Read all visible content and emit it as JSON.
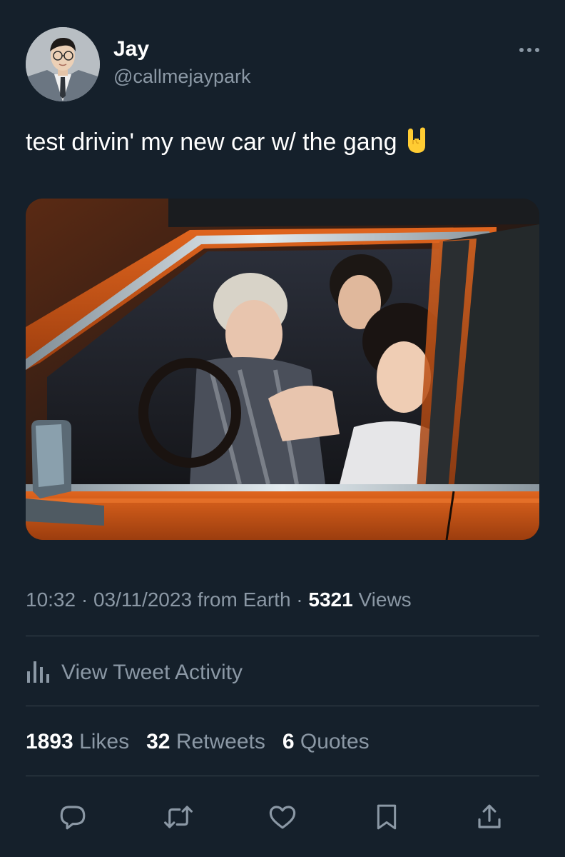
{
  "author": {
    "display_name": "Jay",
    "handle": "@callmejaypark"
  },
  "tweet": {
    "text": "test drivin' my new car w/ the gang",
    "emoji": "sign-of-the-horns"
  },
  "meta": {
    "time": "10:32",
    "separator": " · ",
    "date": "03/11/2023",
    "source": " from Earth",
    "views_count": "5321",
    "views_label": " Views"
  },
  "activity": {
    "label": "View Tweet Activity",
    "icon": "analytics-icon"
  },
  "stats": {
    "likes_count": "1893",
    "likes_label": " Likes",
    "retweets_count": "32",
    "retweets_label": " Retweets",
    "quotes_count": "6",
    "quotes_label": " Quotes"
  },
  "actions": [
    "reply-icon",
    "retweet-icon",
    "like-icon",
    "bookmark-icon",
    "share-icon"
  ],
  "colors": {
    "background": "#15202b",
    "text_primary": "#ffffff",
    "text_secondary": "#8b98a5",
    "divider": "#38444d"
  }
}
